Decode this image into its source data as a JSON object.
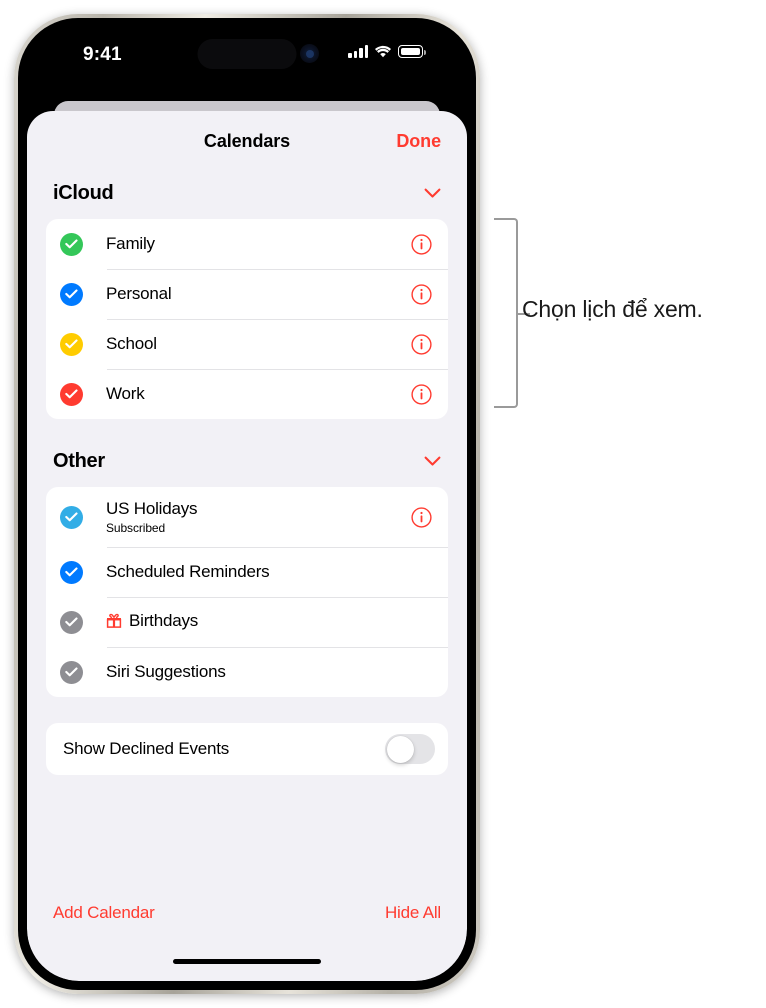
{
  "status_bar": {
    "time": "9:41",
    "signal_icon": "cellular-bars-icon",
    "wifi_icon": "wifi-icon",
    "battery_icon": "battery-icon"
  },
  "nav": {
    "title": "Calendars",
    "done_label": "Done"
  },
  "groups": [
    {
      "title": "iCloud",
      "chevron_icon": "chevron-down-icon",
      "rows": [
        {
          "label": "Family",
          "subtitle": "",
          "check_color": "#34C759",
          "has_info": true,
          "icon": ""
        },
        {
          "label": "Personal",
          "subtitle": "",
          "check_color": "#007AFF",
          "has_info": true,
          "icon": ""
        },
        {
          "label": "School",
          "subtitle": "",
          "check_color": "#FFCC00",
          "has_info": true,
          "icon": ""
        },
        {
          "label": "Work",
          "subtitle": "",
          "check_color": "#FF3B30",
          "has_info": true,
          "icon": ""
        }
      ]
    },
    {
      "title": "Other",
      "chevron_icon": "chevron-down-icon",
      "rows": [
        {
          "label": "US Holidays",
          "subtitle": "Subscribed",
          "check_color": "#32ADE6",
          "has_info": true,
          "icon": ""
        },
        {
          "label": "Scheduled Reminders",
          "subtitle": "",
          "check_color": "#007AFF",
          "has_info": false,
          "icon": ""
        },
        {
          "label": "Birthdays",
          "subtitle": "",
          "check_color": "#8E8E93",
          "has_info": false,
          "icon": "gift-icon"
        },
        {
          "label": "Siri Suggestions",
          "subtitle": "",
          "check_color": "#8E8E93",
          "has_info": false,
          "icon": ""
        }
      ]
    }
  ],
  "settings": {
    "show_declined_label": "Show Declined Events",
    "show_declined_on": false
  },
  "toolbar": {
    "add_calendar_label": "Add Calendar",
    "hide_all_label": "Hide All"
  },
  "annotation": {
    "text": "Chọn lịch để xem."
  },
  "colors": {
    "accent_red": "#FF3B30",
    "sheet_bg": "#F2F1F6",
    "card_bg": "#FFFFFF",
    "divider": "#E3E3E6",
    "gray_check": "#8E8E93",
    "callout_line": "#9A9A9A"
  }
}
